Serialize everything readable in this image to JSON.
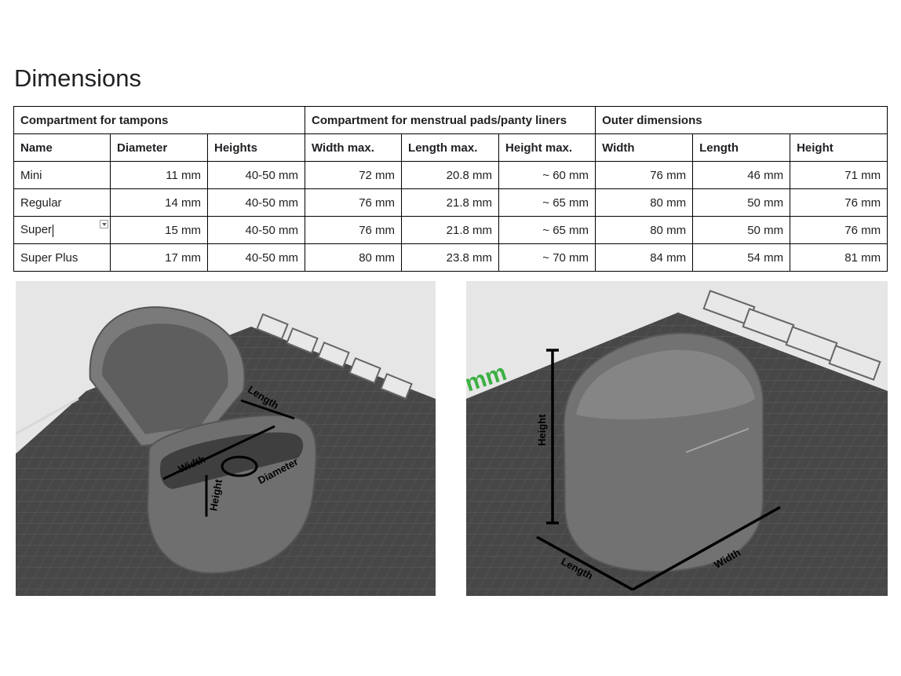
{
  "heading": "Dimensions",
  "table": {
    "groups": [
      "Compartment for tampons",
      "Compartment for menstrual pads/panty liners",
      "Outer dimensions"
    ],
    "columns": [
      "Name",
      "Diameter",
      "Heights",
      "Width max.",
      "Length max.",
      "Height max.",
      "Width",
      "Length",
      "Height"
    ],
    "rows": [
      [
        "Mini",
        "11 mm",
        "40-50 mm",
        "72 mm",
        "20.8 mm",
        "~ 60 mm",
        "76 mm",
        "46 mm",
        "71 mm"
      ],
      [
        "Regular",
        "14 mm",
        "40-50 mm",
        "76 mm",
        "21.8 mm",
        "~ 65 mm",
        "80 mm",
        "50 mm",
        "76 mm"
      ],
      [
        "Super",
        "15 mm",
        "40-50 mm",
        "76 mm",
        "21.8 mm",
        "~ 65 mm",
        "80 mm",
        "50 mm",
        "76 mm"
      ],
      [
        "Super Plus",
        "17 mm",
        "40-50 mm",
        "80 mm",
        "23.8 mm",
        "~ 70 mm",
        "84 mm",
        "54 mm",
        "81 mm"
      ]
    ]
  },
  "images": {
    "left": {
      "labels": {
        "width": "Width",
        "length": "Length",
        "diameter": "Diameter",
        "height": "Height"
      }
    },
    "right": {
      "labels": {
        "height": "Height",
        "length": "Length",
        "width": "Width"
      },
      "bed_text": "mm"
    }
  },
  "colors": {
    "bed": "#4a4a4a",
    "case": "#6e6e6e",
    "background": "#e6e6e6",
    "accent": "#3cb043"
  }
}
